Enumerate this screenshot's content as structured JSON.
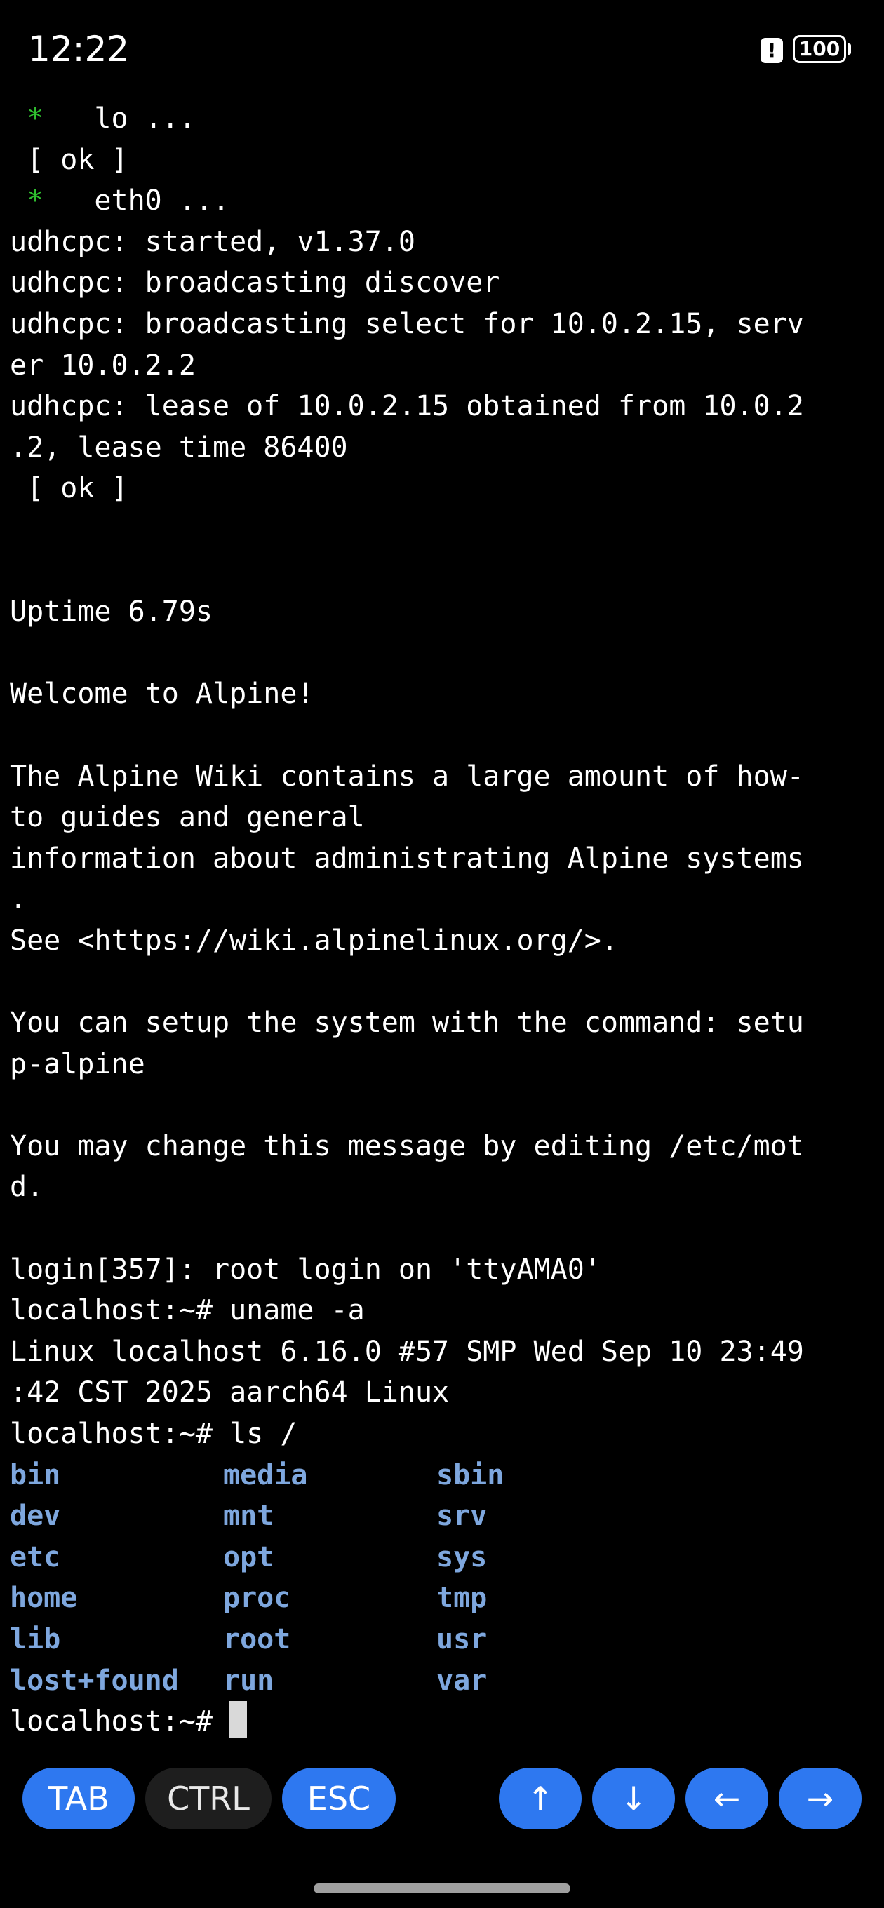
{
  "status_bar": {
    "time": "12:22",
    "alert_glyph": "!",
    "battery_level": "100",
    "alert_icon": "alert-icon",
    "battery_icon": "battery-icon"
  },
  "terminal": {
    "lines": [
      {
        "star": " * ",
        "text": "  lo ..."
      },
      {
        "text": " [ ok ]"
      },
      {
        "star": " * ",
        "text": "  eth0 ..."
      },
      {
        "text": "udhcpc: started, v1.37.0"
      },
      {
        "text": "udhcpc: broadcasting discover"
      },
      {
        "text": "udhcpc: broadcasting select for 10.0.2.15, serv"
      },
      {
        "text": "er 10.0.2.2"
      },
      {
        "text": "udhcpc: lease of 10.0.2.15 obtained from 10.0.2"
      },
      {
        "text": ".2, lease time 86400"
      },
      {
        "text": " [ ok ]"
      },
      {
        "text": ""
      },
      {
        "text": ""
      },
      {
        "text": "Uptime 6.79s"
      },
      {
        "text": ""
      },
      {
        "text": "Welcome to Alpine!"
      },
      {
        "text": ""
      },
      {
        "text": "The Alpine Wiki contains a large amount of how-"
      },
      {
        "text": "to guides and general"
      },
      {
        "text": "information about administrating Alpine systems"
      },
      {
        "text": "."
      },
      {
        "text": "See <https://wiki.alpinelinux.org/>."
      },
      {
        "text": ""
      },
      {
        "text": "You can setup the system with the command: setu"
      },
      {
        "text": "p-alpine"
      },
      {
        "text": ""
      },
      {
        "text": "You may change this message by editing /etc/mot"
      },
      {
        "text": "d."
      },
      {
        "text": ""
      },
      {
        "text": "login[357]: root login on 'ttyAMA0'"
      },
      {
        "text": "localhost:~# uname -a"
      },
      {
        "text": "Linux localhost 6.16.0 #57 SMP Wed Sep 10 23:49"
      },
      {
        "text": ":42 CST 2025 aarch64 Linux"
      },
      {
        "text": "localhost:~# ls /"
      }
    ],
    "ls_rows": [
      [
        "bin",
        "media",
        "sbin"
      ],
      [
        "dev",
        "mnt",
        "srv"
      ],
      [
        "etc",
        "opt",
        "sys"
      ],
      [
        "home",
        "proc",
        "tmp"
      ],
      [
        "lib",
        "root",
        "usr"
      ],
      [
        "lost+found",
        "run",
        "var"
      ]
    ],
    "prompt": "localhost:~# ",
    "colors": {
      "background": "#000000",
      "text": "#ffffff",
      "star": "#2fc12f",
      "directory": "#7ea7de",
      "cursor": "#d9d9d9"
    }
  },
  "keybar": {
    "tab": "TAB",
    "ctrl": "CTRL",
    "esc": "ESC",
    "up": "↑",
    "down": "↓",
    "left": "←",
    "right": "→",
    "accent_color": "#2e78f0"
  }
}
